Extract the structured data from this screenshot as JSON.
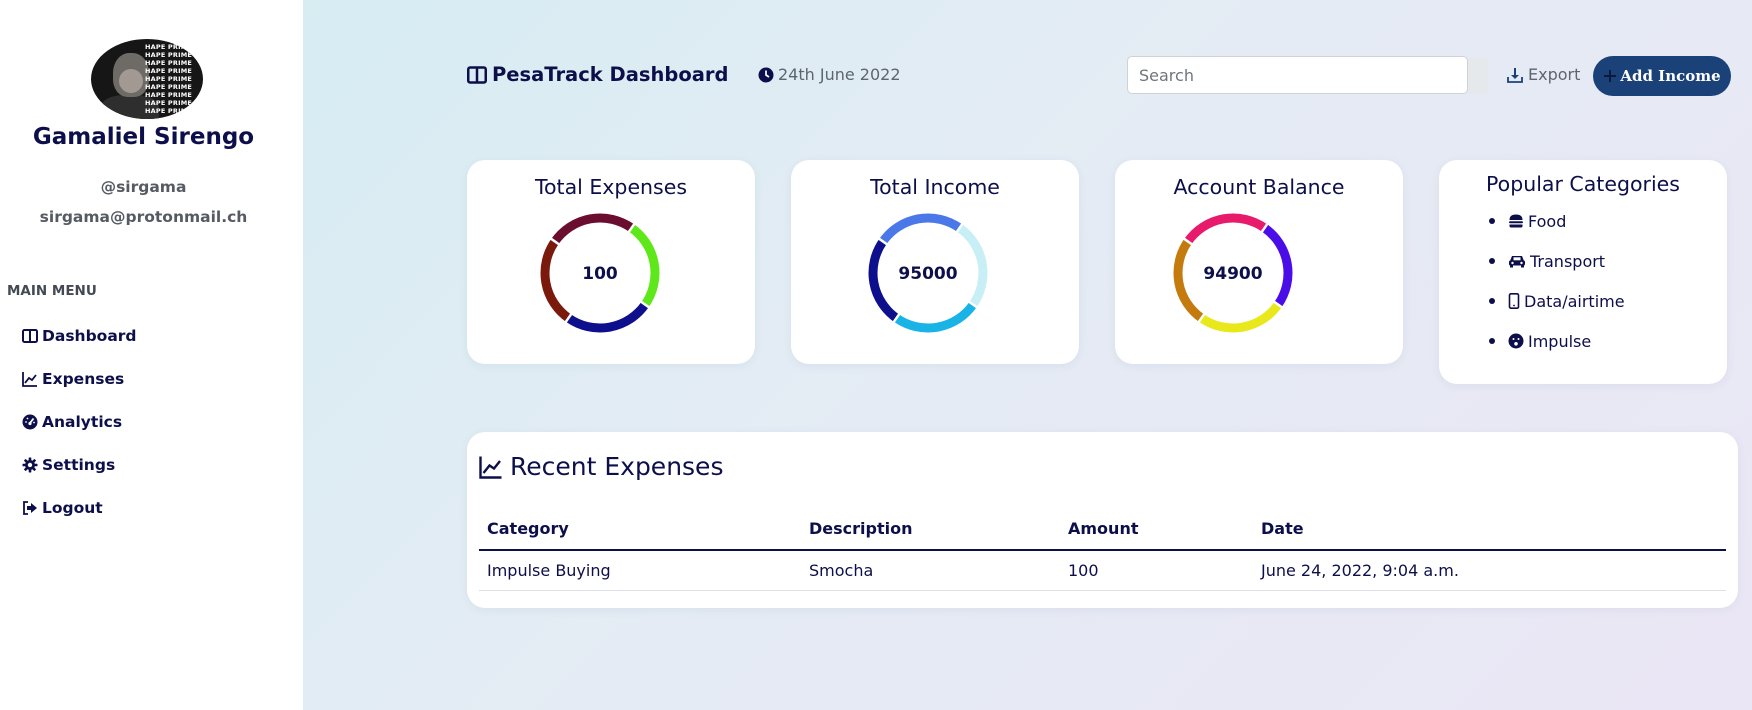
{
  "user": {
    "name": "Gamaliel Sirengo",
    "handle": "@sirgama",
    "email": "sirgama@protonmail.ch",
    "avatar_text": "HAPE PRIME"
  },
  "sidebar": {
    "menu_heading": "MAIN MENU",
    "items": [
      {
        "label": "Dashboard",
        "icon": "layout-columns-icon"
      },
      {
        "label": "Expenses",
        "icon": "line-chart-icon"
      },
      {
        "label": "Analytics",
        "icon": "gauge-icon"
      },
      {
        "label": "Settings",
        "icon": "gear-icon"
      },
      {
        "label": "Logout",
        "icon": "sign-out-icon"
      }
    ]
  },
  "header": {
    "title": "PesaTrack Dashboard",
    "date": "24th June 2022",
    "search_placeholder": "Search",
    "export_label": "Export",
    "add_income_label": "Add Income"
  },
  "cards": {
    "total_expenses": {
      "title": "Total Expenses",
      "value": "100",
      "ring_colors": [
        "#5ee81a",
        "#0d0f8c",
        "#7a1a0c",
        "#6b0d2e"
      ]
    },
    "total_income": {
      "title": "Total Income",
      "value": "95000",
      "ring_colors": [
        "#c7eff5",
        "#1ab3e6",
        "#0d0f8c",
        "#4a78e8"
      ]
    },
    "account_balance": {
      "title": "Account Balance",
      "value": "94900",
      "ring_colors": [
        "#4a0de8",
        "#e8e81a",
        "#c47a0d",
        "#e81a6b"
      ]
    }
  },
  "popular_categories": {
    "title": "Popular Categories",
    "items": [
      {
        "label": "Food",
        "icon": "burger-icon"
      },
      {
        "label": "Transport",
        "icon": "car-icon"
      },
      {
        "label": "Data/airtime",
        "icon": "mobile-phone-icon"
      },
      {
        "label": "Impulse",
        "icon": "surprised-face-icon"
      }
    ]
  },
  "recent_expenses": {
    "title": "Recent Expenses",
    "columns": [
      "Category",
      "Description",
      "Amount",
      "Date"
    ],
    "rows": [
      {
        "category": "Impulse Buying",
        "description": "Smocha",
        "amount": "100",
        "date": "June 24, 2022, 9:04 a.m."
      }
    ]
  },
  "colors": {
    "navy_text": "#0d0f4a",
    "primary_button": "#1b4278",
    "muted_text": "#5d6570"
  }
}
